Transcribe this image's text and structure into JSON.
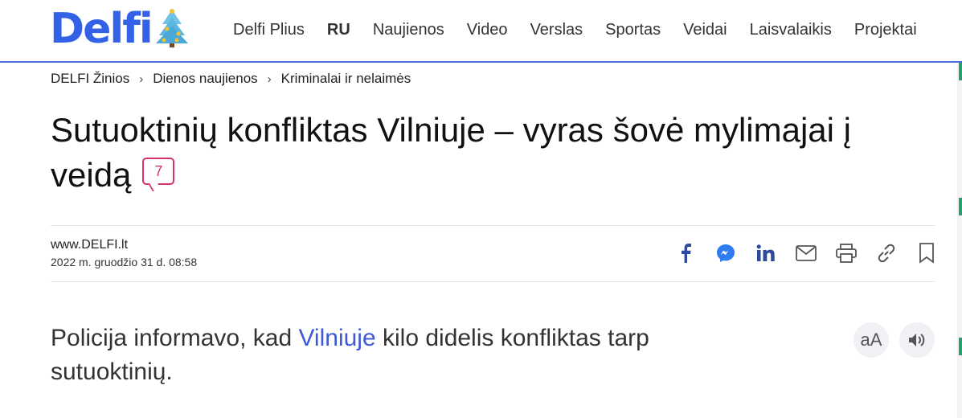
{
  "header": {
    "logo_text": "Delfi",
    "nav": [
      {
        "label": "Delfi Plius",
        "bold": false
      },
      {
        "label": "RU",
        "bold": true
      },
      {
        "label": "Naujienos",
        "bold": false
      },
      {
        "label": "Video",
        "bold": false
      },
      {
        "label": "Verslas",
        "bold": false
      },
      {
        "label": "Sportas",
        "bold": false
      },
      {
        "label": "Veidai",
        "bold": false
      },
      {
        "label": "Laisvalaikis",
        "bold": false
      },
      {
        "label": "Projektai",
        "bold": false
      }
    ]
  },
  "breadcrumb": [
    "DELFI Žinios",
    "Dienos naujienos",
    "Kriminalai ir nelaimės"
  ],
  "article": {
    "title": "Sutuoktinių konfliktas Vilniuje – vyras šovė mylimajai į veidą",
    "comment_count": "7",
    "source": "www.DELFI.lt",
    "date": "2022 m. gruodžio 31 d. 08:58",
    "lead_before": "Policija informavo, kad ",
    "lead_link": "Vilniuje",
    "lead_after": " kilo didelis konfliktas tarp sutuoktinių."
  },
  "share_icons": [
    "facebook-icon",
    "messenger-icon",
    "linkedin-icon",
    "mail-icon",
    "print-icon",
    "link-icon",
    "bookmark-icon"
  ],
  "tools": {
    "font_size_label": "aA"
  },
  "colors": {
    "brand": "#3362e6",
    "accent": "#d6336c",
    "link": "#3e5ad6"
  }
}
